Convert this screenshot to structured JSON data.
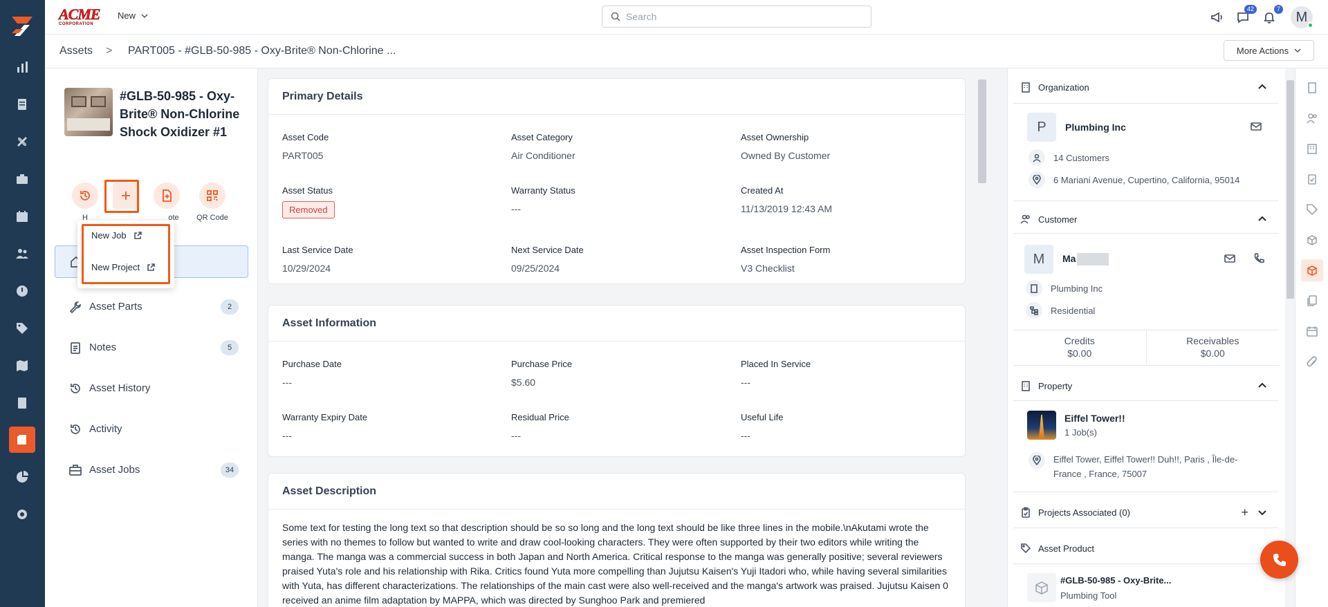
{
  "brand": {
    "logo_text": "ACME",
    "logo_sub": "CORPORATION"
  },
  "topbar": {
    "new_label": "New",
    "search_placeholder": "Search",
    "chat_badge": "42",
    "notif_badge": "7",
    "avatar_initial": "M"
  },
  "breadcrumb": {
    "root": "Assets",
    "separator": ">",
    "current": "PART005 - #GLB-50-985 - Oxy-Brite® Non-Chlorine ...",
    "more_actions": "More Actions"
  },
  "asset": {
    "title": "#GLB-50-985 - Oxy-Brite® Non-Chlorine Shock Oxidizer #1",
    "actions": [
      {
        "label": "H",
        "icon": "history-icon"
      },
      {
        "label": "",
        "icon": "plus-icon"
      },
      {
        "label": "ote",
        "icon": "quote-icon"
      },
      {
        "label": "QR Code",
        "icon": "qr-code-icon"
      }
    ]
  },
  "dropdown": {
    "items": [
      {
        "label": "New Job",
        "icon": "external-link-icon"
      },
      {
        "label": "New Project",
        "icon": "external-link-icon"
      }
    ]
  },
  "side_nav": {
    "items": [
      {
        "label": "",
        "icon": "home-icon",
        "count": ""
      },
      {
        "label": "Asset Parts",
        "icon": "wrench-icon",
        "count": "2"
      },
      {
        "label": "Notes",
        "icon": "notes-icon",
        "count": "5"
      },
      {
        "label": "Asset History",
        "icon": "history-icon",
        "count": ""
      },
      {
        "label": "Activity",
        "icon": "activity-icon",
        "count": ""
      },
      {
        "label": "Asset Jobs",
        "icon": "briefcase-icon",
        "count": "34"
      }
    ]
  },
  "primary": {
    "title": "Primary Details",
    "fields": [
      {
        "label": "Asset Code",
        "value": "PART005"
      },
      {
        "label": "Asset Category",
        "value": "Air Conditioner"
      },
      {
        "label": "Asset Ownership",
        "value": "Owned By Customer"
      },
      {
        "label": "Asset Status",
        "value": "Removed"
      },
      {
        "label": "Warranty Status",
        "value": "---"
      },
      {
        "label": "Created At",
        "value": "11/13/2019 12:43 AM"
      },
      {
        "label": "Last Service Date",
        "value": "10/29/2024"
      },
      {
        "label": "Next Service Date",
        "value": "09/25/2024"
      },
      {
        "label": "Asset Inspection Form",
        "value": "V3 Checklist"
      }
    ]
  },
  "info": {
    "title": "Asset Information",
    "fields": [
      {
        "label": "Purchase Date",
        "value": "---"
      },
      {
        "label": "Purchase Price",
        "value": "$5.60"
      },
      {
        "label": "Placed In Service",
        "value": "---"
      },
      {
        "label": "Warranty Expiry Date",
        "value": "---"
      },
      {
        "label": "Residual Price",
        "value": "---"
      },
      {
        "label": "Useful Life",
        "value": "---"
      }
    ]
  },
  "description": {
    "title": "Asset Description",
    "text": "Some text for testing the long text so that description should be so so long and the long text should be like three lines in the mobile.\\nAkutami wrote the series with no themes to follow but wanted to write and draw cool-looking characters. They were often supported by their two editors while writing the manga. The manga was a commercial success in both Japan and North America. Critical response to the manga was generally positive; several reviewers praised Yuta's role and his relationship with Rika. Critics found Yuta more compelling than Jujutsu Kaisen's Yuji Itadori who, while having several similarities with Yuta, has different characterizations. The relationships of the main cast were also well-received and the manga's artwork was praised. Jujutsu Kaisen 0 received an anime film adaptation by MAPPA, which was directed by Sunghoo Park and premiered"
  },
  "organization": {
    "title": "Organization",
    "initial": "P",
    "name": "Plumbing Inc",
    "customers": "14 Customers",
    "address": "6 Mariani Avenue, Cupertino, California, 95014"
  },
  "customer": {
    "title": "Customer",
    "initial": "M",
    "name": "Ma",
    "org": "Plumbing Inc",
    "type": "Residential",
    "credits_label": "Credits",
    "credits_value": "$0.00",
    "receivables_label": "Receivables",
    "receivables_value": "$0.00"
  },
  "property": {
    "title": "Property",
    "name": "Eiffel Tower!!",
    "jobs": "1 Job(s)",
    "address": "Eiffel Tower, Eiffel Tower!! Duh!!, Paris , Île-de-France , France, 75007"
  },
  "projects": {
    "title": "Projects Associated (0)"
  },
  "product": {
    "title": "Asset Product",
    "name": "#GLB-50-985 - Oxy-Brite...",
    "vendor": "Plumbing Tool"
  },
  "colors": {
    "accent": "#ea5a2a",
    "rail": "#1f3a52",
    "highlight": "#f05a16"
  }
}
